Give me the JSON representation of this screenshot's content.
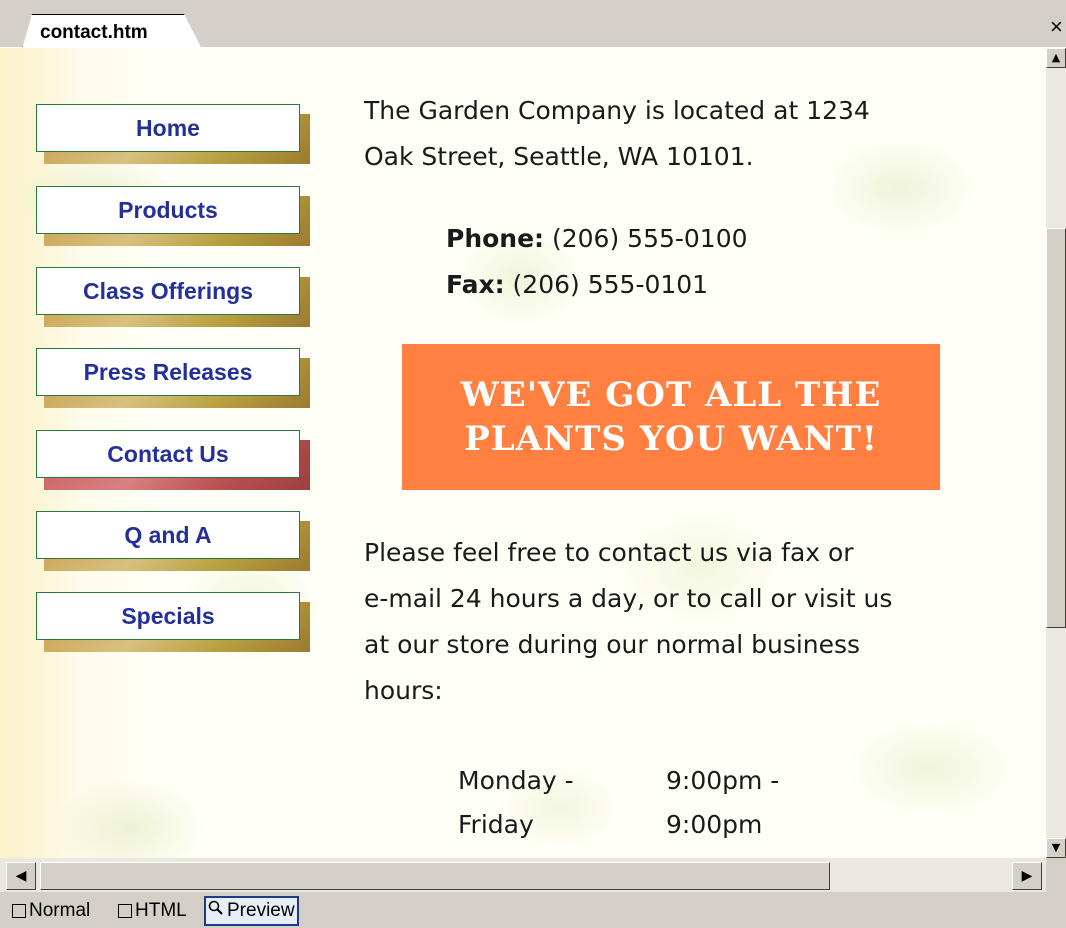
{
  "tab": {
    "title": "contact.htm",
    "close_glyph": "×"
  },
  "nav": {
    "items": [
      {
        "label": "Home",
        "name": "nav-home-button"
      },
      {
        "label": "Products",
        "name": "nav-products-button"
      },
      {
        "label": "Class Offerings",
        "name": "nav-class-offerings-button"
      },
      {
        "label": "Press Releases",
        "name": "nav-press-releases-button"
      },
      {
        "label": "Contact Us",
        "name": "nav-contact-us-button"
      },
      {
        "label": "Q and A",
        "name": "nav-q-and-a-button"
      },
      {
        "label": "Specials",
        "name": "nav-specials-button"
      }
    ],
    "active": "Contact Us"
  },
  "content": {
    "address_line1": "The Garden Company is located at 1234",
    "address_line2": "Oak Street, Seattle, WA  10101.",
    "phone_label": "Phone:",
    "phone_value": " (206) 555-0100",
    "fax_label": "Fax:",
    "fax_value": " (206) 555-0101",
    "banner_line1": "WE'VE GOT ALL THE",
    "banner_line2": "PLANTS YOU WANT!",
    "contact_line1": "Please feel free to contact us via fax or",
    "contact_line2": "e-mail 24 hours a day, or to call or visit us",
    "contact_line3": "at our store during our normal business",
    "contact_line4": "hours:",
    "hours_days_1": "Monday -",
    "hours_days_2": "Friday",
    "hours_time_1": "9:00pm -",
    "hours_time_2": "9:00pm"
  },
  "view_tabs": {
    "normal": "Normal",
    "html": "HTML",
    "preview": "Preview",
    "active": "Preview"
  },
  "colors": {
    "banner": "#ff8040",
    "nav_text": "#24309a",
    "nav_border": "#2a7a3a"
  }
}
